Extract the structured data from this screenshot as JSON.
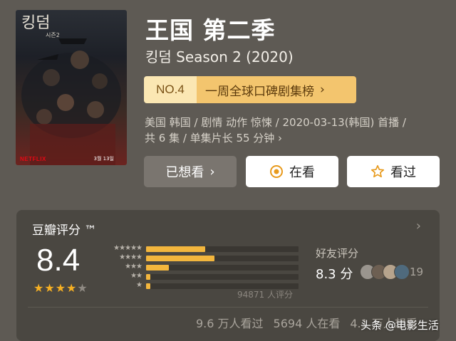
{
  "poster": {
    "title_logo": "킹덤",
    "subtitle_logo": "시즌2",
    "brand": "NETFLIX",
    "date": "3월 13일"
  },
  "header": {
    "title": "王国 第二季",
    "original_title": "킹덤 Season 2 (2020)"
  },
  "ranking": {
    "rank_label": "NO.4",
    "list_name": "一周全球口碑剧集榜",
    "chevron": "›"
  },
  "meta": {
    "line1": "美国 韩国 / 剧情 动作 惊悚 / 2020-03-13(韩国) 首播 /",
    "line2": "共 6 集 / 单集片长 55 分钟 ›"
  },
  "actions": {
    "wish_label": "已想看",
    "wish_chevron": "›",
    "watching_label": "在看",
    "watched_label": "看过"
  },
  "rating": {
    "section_title": "豆瓣评分 ™",
    "arrow": "›",
    "score": "8.4",
    "stars": 4,
    "distribution": [
      0.39,
      0.45,
      0.15,
      0.03,
      0.03
    ],
    "votes": "94871 人评分",
    "friend_label": "好友评分",
    "friend_score": "8.3 分",
    "friend_count": "19"
  },
  "counts": {
    "watched": "9.6 万人看过",
    "watching": "5694 人在看",
    "wish": "4.1 万人想看"
  },
  "watermark": "头条 @电影生活",
  "colors": {
    "background": "#5e5a54",
    "card": "#4a4741",
    "accent": "#f3b63d",
    "rank_badge": "#fbe7b3",
    "rank_bar": "#f3c56e",
    "watching_icon": "#e89a1c",
    "watched_icon": "#e89a1c"
  },
  "icons": {
    "watching": "target-circle-icon",
    "watched": "star-outline-icon"
  }
}
